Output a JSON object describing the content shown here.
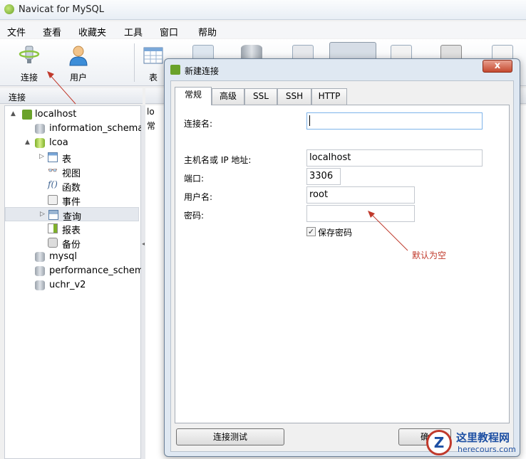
{
  "app": {
    "title": "Navicat for MySQL"
  },
  "menu": [
    "文件",
    "查看",
    "收藏夹",
    "工具",
    "窗口",
    "帮助"
  ],
  "toolbar": {
    "connect_label": "连接",
    "user_label": "用户",
    "table_label": "表"
  },
  "connections": {
    "header": "连接",
    "tree": [
      {
        "label": "localhost",
        "level": 0,
        "icon": "connection-icon",
        "toggle": "▲"
      },
      {
        "label": "information_schema",
        "level": 1,
        "icon": "database-icon"
      },
      {
        "label": "lcoa",
        "level": 1,
        "icon": "database-open-icon",
        "toggle": "▲"
      },
      {
        "label": "表",
        "level": 2,
        "icon": "table-icon",
        "toggle": "▷"
      },
      {
        "label": "视图",
        "level": 2,
        "icon": "view-icon"
      },
      {
        "label": "函数",
        "level": 2,
        "icon": "function-icon"
      },
      {
        "label": "事件",
        "level": 2,
        "icon": "event-icon"
      },
      {
        "label": "查询",
        "level": 2,
        "icon": "query-icon",
        "toggle": "▷",
        "selected": true
      },
      {
        "label": "报表",
        "level": 2,
        "icon": "report-icon"
      },
      {
        "label": "备份",
        "level": 2,
        "icon": "backup-icon"
      },
      {
        "label": "mysql",
        "level": 1,
        "icon": "database-icon"
      },
      {
        "label": "performance_schema",
        "level": 1,
        "icon": "database-icon"
      },
      {
        "label": "uchr_v2",
        "level": 1,
        "icon": "database-icon"
      }
    ]
  },
  "objects": {
    "rows": [
      "lo",
      "常"
    ]
  },
  "dialog": {
    "title": "新建连接",
    "close": "x",
    "tabs": [
      "常规",
      "高级",
      "SSL",
      "SSH",
      "HTTP"
    ],
    "fields": {
      "conn_name_label": "连接名:",
      "conn_name_value": "",
      "host_label": "主机名或 IP 地址:",
      "host_value": "localhost",
      "port_label": "端口:",
      "port_value": "3306",
      "user_label": "用户名:",
      "user_value": "root",
      "password_label": "密码:",
      "password_value": "",
      "save_password_label": "保存密码",
      "save_password_checked": true
    },
    "test_button": "连接测试",
    "ok_button": "确"
  },
  "annotation": {
    "text": "默认为空",
    "color": "#c0392b"
  },
  "watermark": {
    "cn": "这里教程网",
    "en": "herecours.com"
  }
}
